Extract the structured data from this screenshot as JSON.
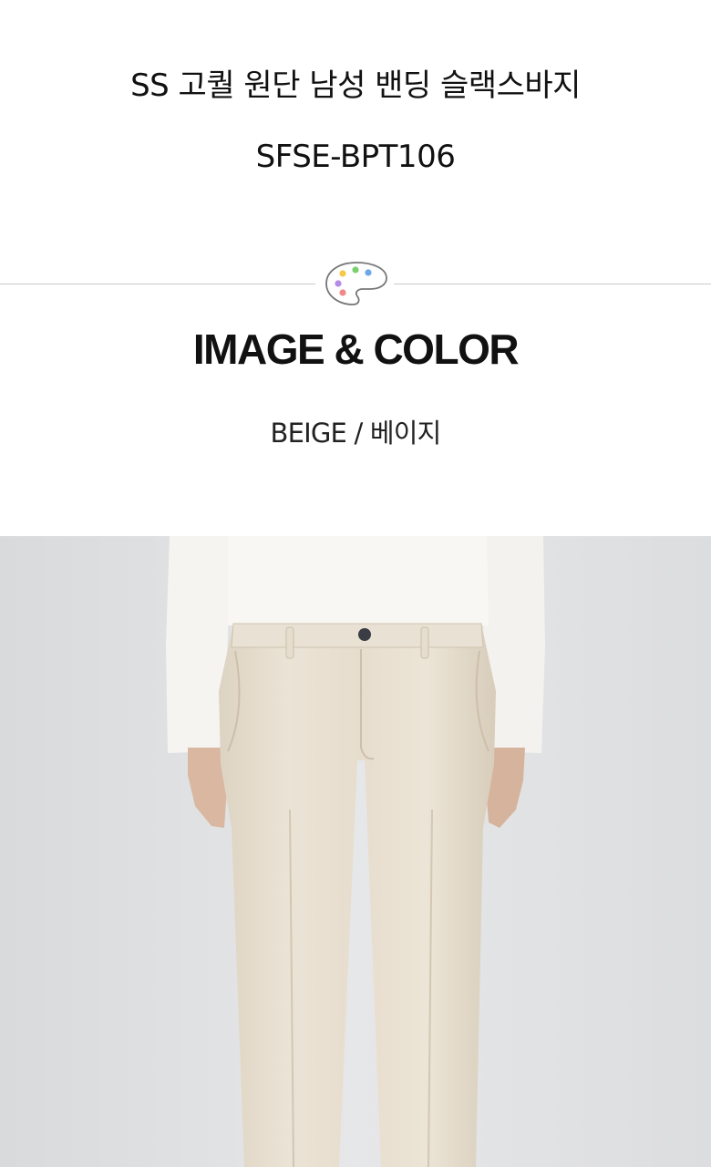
{
  "product": {
    "title": "SS 고퀄 원단 남성 밴딩 슬랙스바지",
    "code": "SFSE-BPT106"
  },
  "section": {
    "icon": "palette-icon",
    "heading": "IMAGE & COLOR"
  },
  "color": {
    "name": "BEIGE / 베이지",
    "swatch": "#e9e0d2"
  },
  "palette_dots": [
    "#f7c948",
    "#7ccf6f",
    "#6aa8e8",
    "#b58be8",
    "#f08a8a"
  ]
}
